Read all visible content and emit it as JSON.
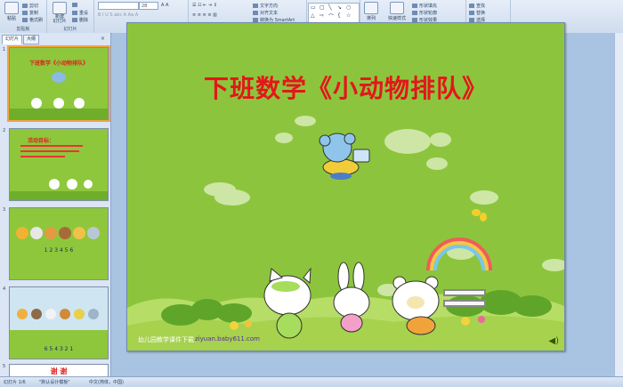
{
  "ribbon": {
    "paste": "粘贴",
    "cut": "剪切",
    "copy": "复制",
    "format_painter": "格式刷",
    "new_slide": "新建\n幻灯片",
    "reset": "重设",
    "delete": "删除",
    "font_size": "28",
    "text_direction": "文字方向",
    "align_text": "对齐文本",
    "convert_smartart": "转换为 SmartArt",
    "arrange": "排列",
    "quick_styles": "快速样式",
    "shape_fill": "形状填充",
    "shape_outline": "形状轮廓",
    "shape_effects": "形状效果",
    "find": "查找",
    "replace": "替换",
    "select": "选择",
    "group_clipboard": "剪贴板",
    "group_slides": "幻灯片"
  },
  "leftpane": {
    "tab_slides": "幻灯片",
    "tab_outline": "大纲",
    "thumbs": [
      {
        "num": "1",
        "title": "下班数学《小动物排队》"
      },
      {
        "num": "2",
        "title": "活动目标："
      },
      {
        "num": "3",
        "title": "1   2   3   4   5   6"
      },
      {
        "num": "4",
        "title": "6   5   4   3   2   1"
      },
      {
        "num": "5",
        "title": "谢  谢"
      }
    ]
  },
  "slide": {
    "title": "下班数学《小动物排队》",
    "footer_text": "幼儿园教学课件下载",
    "footer_url": "ziyuan.baby611.com"
  },
  "statusbar": {
    "slide_info": "幻灯片 1/6",
    "theme": "\"默认设计模板\"",
    "language": "中文(简体，中国)"
  }
}
